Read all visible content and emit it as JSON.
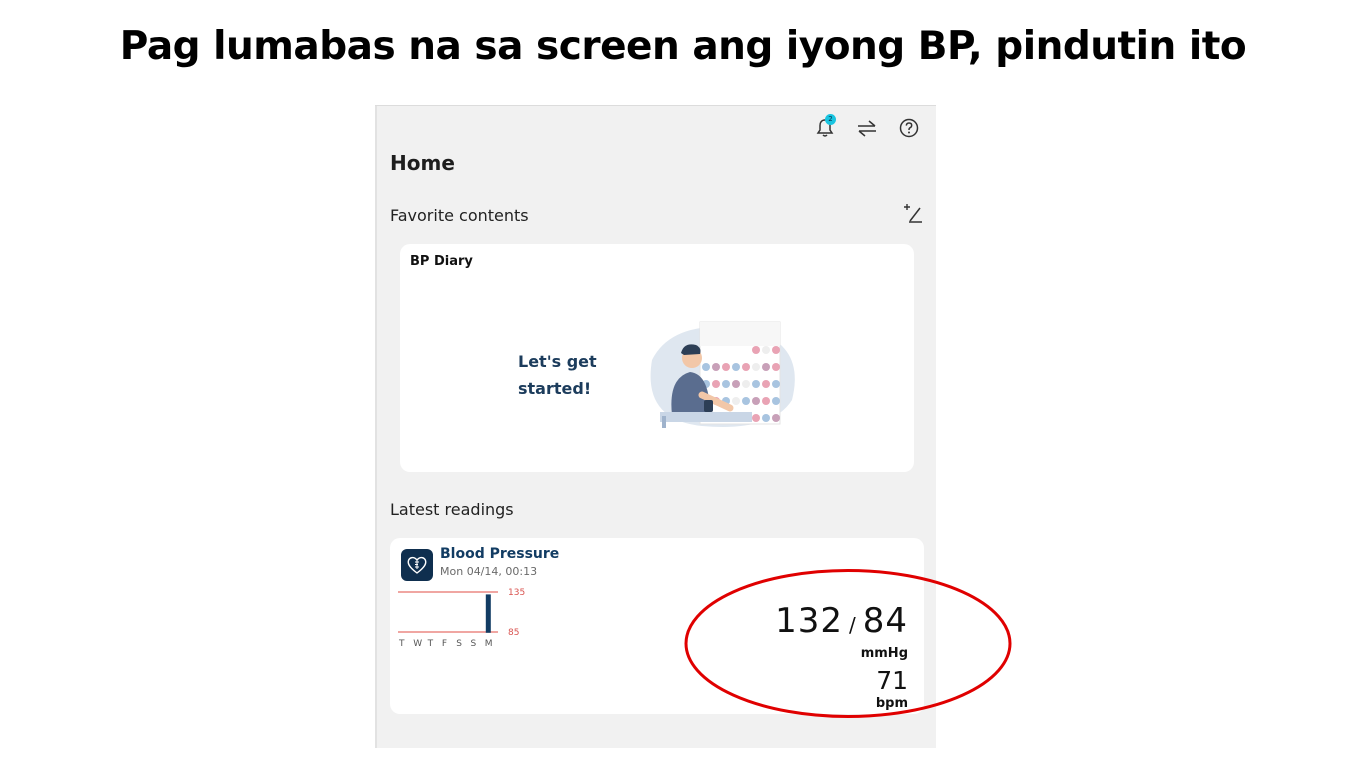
{
  "headline": "Pag lumabas na sa screen ang iyong BP, pindutin ito",
  "topbar": {
    "notification_count": "2",
    "icons": [
      "bell-icon",
      "swap-icon",
      "help-icon"
    ]
  },
  "home": {
    "title": "Home",
    "favorite_contents_label": "Favorite contents",
    "bp_diary": {
      "title": "BP Diary",
      "cta": "Let's get started!"
    },
    "latest_readings_label": "Latest readings",
    "blood_pressure": {
      "title": "Blood Pressure",
      "timestamp": "Mon 04/14, 00:13",
      "systolic": "132",
      "separator": "/",
      "diastolic": "84",
      "bp_unit": "mmHg",
      "pulse": "71",
      "pulse_unit": "bpm"
    }
  },
  "chart_data": {
    "type": "bar",
    "categories": [
      "T",
      "W",
      "T",
      "F",
      "S",
      "S",
      "M"
    ],
    "values": [
      null,
      null,
      null,
      null,
      null,
      null,
      [
        84,
        132
      ]
    ],
    "reference_lines": [
      "135",
      "85"
    ],
    "title": "",
    "xlabel": "",
    "ylabel": ""
  },
  "colors": {
    "accent": "#123c63",
    "badge": "#19c4e0",
    "reference_line": "#e8706a",
    "highlight_circle": "#e00000"
  }
}
